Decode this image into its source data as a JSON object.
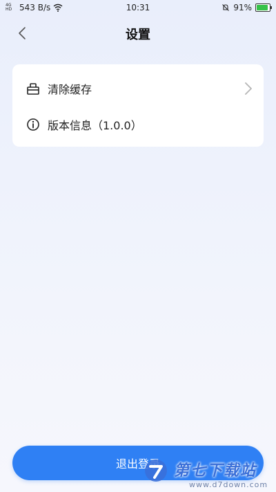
{
  "status_bar": {
    "net_type": "4G HD",
    "speed": "543 B/s",
    "time": "10:31",
    "battery_percent": "91%",
    "battery_level": 0.91,
    "battery_color": "#36c24a"
  },
  "nav": {
    "title": "设置",
    "back_icon": "chevron-left-icon"
  },
  "settings": {
    "items": [
      {
        "label": "清除缓存",
        "icon": "basket-icon",
        "has_chevron": true
      },
      {
        "label": "版本信息（1.0.0）",
        "icon": "info-icon",
        "has_chevron": false
      }
    ]
  },
  "logout": {
    "label": "退出登录",
    "color": "#2f80f4"
  },
  "watermark": {
    "text": "第七下载站",
    "url": "www.d7down.com"
  }
}
